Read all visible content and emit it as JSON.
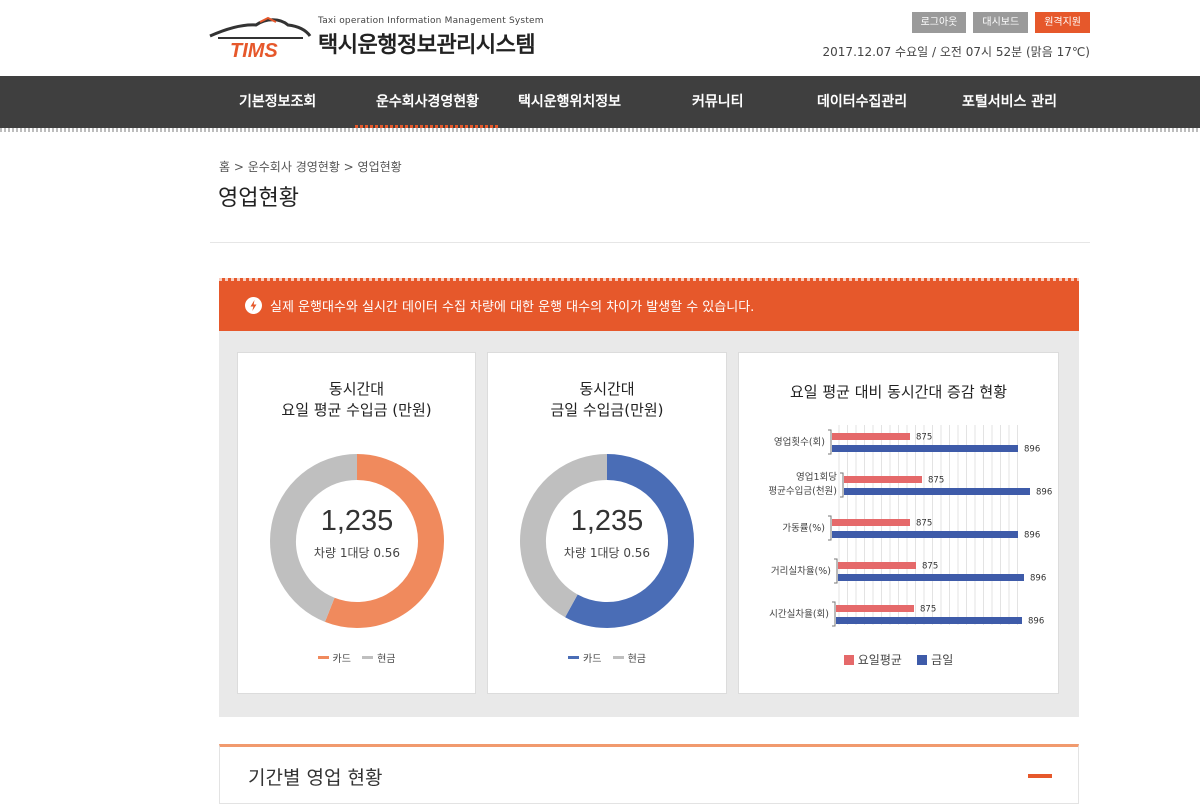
{
  "header": {
    "logo_text": "TIMS",
    "subtitle": "Taxi operation Information Management System",
    "title": "택시운행정보관리시스템",
    "buttons": [
      "로그아웃",
      "대시보드",
      "원격지원"
    ],
    "date_line": "2017.12.07 수요일 / 오전 07시 52분 (맑음 17℃)"
  },
  "nav": {
    "items": [
      "기본정보조회",
      "운수회사경영현황",
      "택시운행위치정보",
      "커뮤니티",
      "데이터수집관리",
      "포털서비스 관리"
    ],
    "active_index": 1
  },
  "breadcrumb": "홈 > 운수회사 경영현황 > 영업현황",
  "page_title": "영업현황",
  "notice": "실제 운행대수와 실시간 데이터 수집 차량에 대한 운행 대수의 차이가 발생할 수 있습니다.",
  "cards": [
    {
      "title_line1": "동시간대",
      "title_line2": "요일 평균 수입금 (만원)",
      "value": "1,235",
      "sub": "차량 1대당 0.56",
      "legend": [
        "카드",
        "현금"
      ],
      "colors": [
        "#f08a5d",
        "#bfbfbf"
      ]
    },
    {
      "title_line1": "동시간대",
      "title_line2": "금일 수입금(만원)",
      "value": "1,235",
      "sub": "차량 1대당 0.56",
      "legend": [
        "카드",
        "현금"
      ],
      "colors": [
        "#4a6db6",
        "#bfbfbf"
      ]
    }
  ],
  "chart_data": [
    {
      "type": "pie",
      "title": "동시간대 요일 평균 수입금 (만원)",
      "categories": [
        "카드",
        "현금"
      ],
      "values": [
        56,
        44
      ],
      "colors": [
        "#f08a5d",
        "#bfbfbf"
      ]
    },
    {
      "type": "pie",
      "title": "동시간대 금일 수입금(만원)",
      "categories": [
        "카드",
        "현금"
      ],
      "values": [
        58,
        42
      ],
      "colors": [
        "#4a6db6",
        "#bfbfbf"
      ]
    },
    {
      "type": "bar",
      "orientation": "horizontal",
      "title": "요일 평균 대비 동시간대 증감 현황",
      "categories": [
        "영업횟수(회)",
        "영업1회당 평균수입금(천원)",
        "가동률(%)",
        "거리실차율(%)",
        "시간실차율(회)"
      ],
      "category_lines": [
        [
          "영업횟수(회)"
        ],
        [
          "영업1회당",
          "평균수입금(천원)"
        ],
        [
          "가동률(%)"
        ],
        [
          "거리실차율(%)"
        ],
        [
          "시간실차율(회)"
        ]
      ],
      "series": [
        {
          "name": "요일평균",
          "values": [
            875,
            875,
            875,
            875,
            875
          ],
          "color": "#e5696a"
        },
        {
          "name": "금일",
          "values": [
            896,
            896,
            896,
            896,
            896
          ],
          "color": "#3e5ba9"
        }
      ],
      "legend": "bottom-center",
      "grid": true
    }
  ],
  "section": {
    "title": "기간별 영업 현황"
  }
}
